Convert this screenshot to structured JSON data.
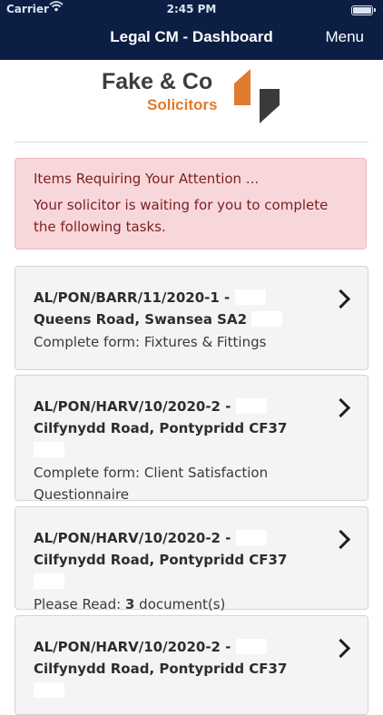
{
  "status_bar": {
    "carrier": "Carrier",
    "time": "2:45 PM"
  },
  "header": {
    "title": "Legal CM - Dashboard",
    "menu_label": "Menu"
  },
  "logo": {
    "line1": "Fake & Co",
    "line2": "Solicitors",
    "colors": {
      "brand_orange": "#e07a2e",
      "brand_dark": "#3d3d3d"
    }
  },
  "attention": {
    "title": "Items Requiring Your Attention ...",
    "message": "Your solicitor is waiting for you to complete the following tasks."
  },
  "tasks": [
    {
      "ref_a": "AL/PON/BARR/11/2020-1 -",
      "ref_b": "Queens",
      "ref_c": "Road, Swansea SA2",
      "desc_a": "Complete form: Fixtures & Fittings",
      "desc_count": "",
      "desc_b": ""
    },
    {
      "ref_a": "AL/PON/HARV/10/2020-2 -",
      "ref_b": "",
      "ref_c": "Cilfynydd Road, Pontypridd CF37",
      "desc_a": "Complete form: Client Satisfaction Questionnaire",
      "desc_count": "",
      "desc_b": ""
    },
    {
      "ref_a": "AL/PON/HARV/10/2020-2 -",
      "ref_b": "",
      "ref_c": "Cilfynydd Road, Pontypridd CF37",
      "desc_a": "Please Read: ",
      "desc_count": "3",
      "desc_b": " document(s)"
    },
    {
      "ref_a": "AL/PON/HARV/10/2020-2 -",
      "ref_b": "",
      "ref_c": "Cilfynydd Road, Pontypridd CF37",
      "desc_a": "",
      "desc_count": "",
      "desc_b": ""
    }
  ],
  "colors": {
    "header_bg": "#0c1e43",
    "alert_bg": "#f8d7da",
    "alert_text": "#7a1f24",
    "card_bg": "#f4f4f6"
  },
  "icons": {
    "wifi": "wifi-icon",
    "battery": "battery-icon",
    "chevron": "chevron-right-icon"
  }
}
